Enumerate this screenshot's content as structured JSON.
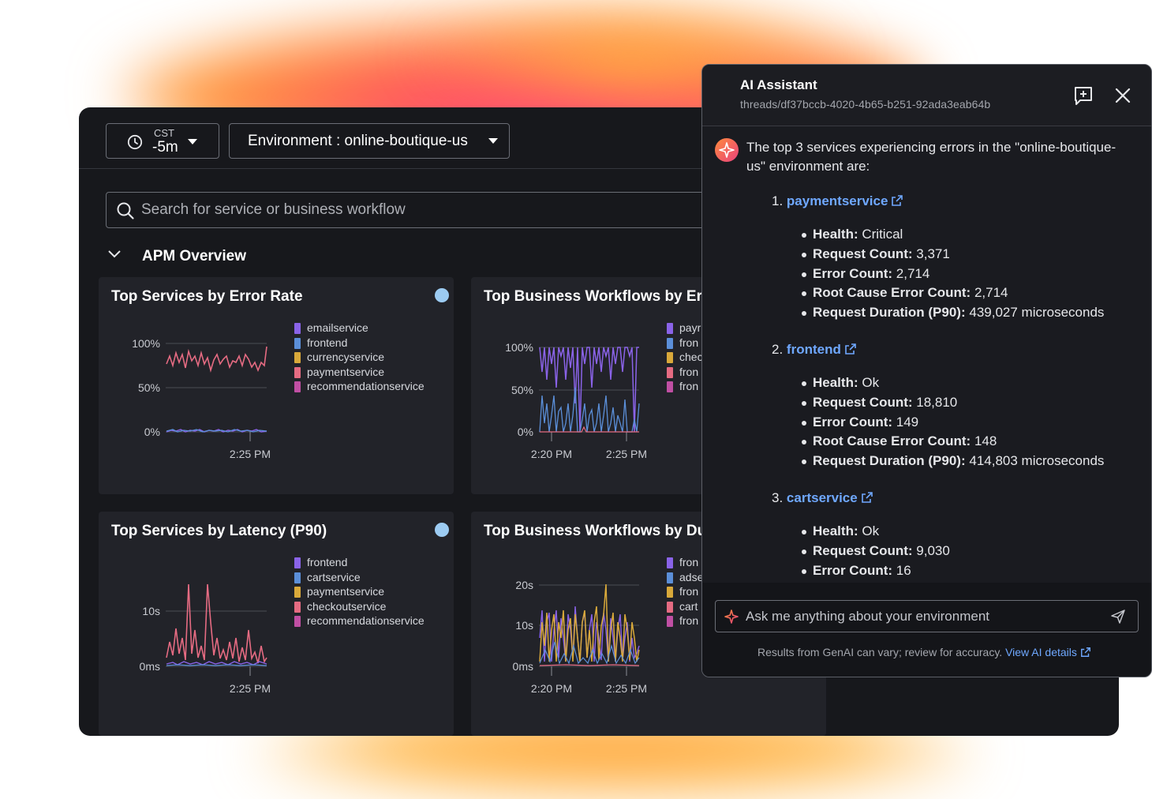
{
  "header": {
    "time_zone": "CST",
    "time_range": "-5m",
    "environment_label": "Environment : online-boutique-us"
  },
  "search": {
    "placeholder": "Search for service or business workflow"
  },
  "section": {
    "title": "APM Overview"
  },
  "cards": [
    {
      "title": "Top Services by Error Rate",
      "legend": [
        "emailservice",
        "frontend",
        "currencyservice",
        "paymentservice",
        "recommendationservice"
      ],
      "y_ticks": [
        "100%",
        "50%",
        "0%"
      ],
      "x_ticks": [
        "2:25 PM"
      ]
    },
    {
      "title": "Top Business Workflows by Er",
      "legend": [
        "payr",
        "fron",
        "chec",
        "fron",
        "fron"
      ],
      "y_ticks": [
        "100%",
        "50%",
        "0%"
      ],
      "x_ticks": [
        "2:20 PM",
        "2:25 PM"
      ]
    },
    {
      "title": "Top Services by Latency (P90)",
      "legend": [
        "frontend",
        "cartservice",
        "paymentservice",
        "checkoutservice",
        "recommendationservice"
      ],
      "y_ticks": [
        "10s",
        "0ms"
      ],
      "x_ticks": [
        "2:25 PM"
      ]
    },
    {
      "title": "Top Business Workflows by Du",
      "legend": [
        "fron",
        "adse",
        "fron",
        "cart",
        "fron"
      ],
      "y_ticks": [
        "20s",
        "10s",
        "0ms"
      ],
      "x_ticks": [
        "2:20 PM",
        "2:25 PM"
      ]
    }
  ],
  "colors": {
    "purple": "#8a63e8",
    "blue": "#5b8fd9",
    "yellow": "#d9a93a",
    "pink": "#e56b82",
    "magenta": "#c04fa3",
    "link": "#6fa8ff"
  },
  "assistant": {
    "title": "AI Assistant",
    "thread": "threads/df37bccb-4020-4b65-b251-92ada3eab64b",
    "intro": "The top 3 services experiencing errors in the \"online-boutique-us\" environment are:",
    "services": [
      {
        "num": "1.",
        "name": "paymentservice",
        "details": [
          {
            "label": "Health:",
            "value": " Critical"
          },
          {
            "label": "Request Count:",
            "value": " 3,371"
          },
          {
            "label": "Error Count:",
            "value": " 2,714"
          },
          {
            "label": "Root Cause Error Count:",
            "value": " 2,714"
          },
          {
            "label": "Request Duration (P90):",
            "value": " 439,027 microseconds"
          }
        ]
      },
      {
        "num": "2.",
        "name": "frontend",
        "details": [
          {
            "label": "Health:",
            "value": " Ok"
          },
          {
            "label": "Request Count:",
            "value": " 18,810"
          },
          {
            "label": "Error Count:",
            "value": " 149"
          },
          {
            "label": "Root Cause Error Count:",
            "value": " 148"
          },
          {
            "label": "Request Duration (P90):",
            "value": " 414,803 microseconds"
          }
        ]
      },
      {
        "num": "3.",
        "name": "cartservice",
        "details": [
          {
            "label": "Health:",
            "value": " Ok"
          },
          {
            "label": "Request Count:",
            "value": " 9,030"
          },
          {
            "label": "Error Count:",
            "value": " 16"
          }
        ]
      }
    ],
    "input_placeholder": "Ask me anything about your environment",
    "disclaimer": "Results from GenAI can vary; review for accuracy.",
    "details_link": "View AI details"
  }
}
